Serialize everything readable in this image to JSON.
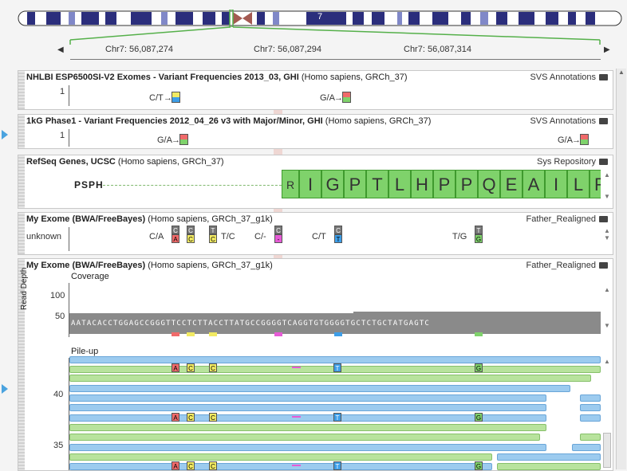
{
  "ideogram": {
    "chromosome_label": "7"
  },
  "ruler": {
    "labels": [
      "Chr7: 56,087,274",
      "Chr7: 56,087,294",
      "Chr7: 56,087,314"
    ]
  },
  "tracks": {
    "esp": {
      "title_bold": "NHLBI ESP6500SI-V2 Exomes - Variant Frequencies 2013_03, GHI",
      "title_rest": " (Homo sapiens, GRCh_37)",
      "source": "SVS Annotations",
      "axis": "1",
      "variants": [
        "C/T",
        "G/A"
      ]
    },
    "kg": {
      "title_bold": "1kG Phase1 - Variant Frequencies 2012_04_26 v3 with Major/Minor, GHI",
      "title_rest": " (Homo sapiens, GRCh_37)",
      "source": "SVS Annotations",
      "axis": "1",
      "variants": [
        "G/A",
        "G/A"
      ]
    },
    "refseq": {
      "title_bold": "RefSeq Genes, UCSC",
      "title_rest": " (Homo sapiens, GRCh_37)",
      "source": "Sys Repository",
      "gene": "PSPH",
      "amino_acids": [
        "R",
        "I",
        "G",
        "P",
        "T",
        "L",
        "H",
        "P",
        "P",
        "Q",
        "E",
        "A",
        "I",
        "L",
        "R"
      ]
    },
    "exome1": {
      "title_bold": "My Exome (BWA/FreeBayes)",
      "title_rest": " (Homo sapiens, GRCh_37_g1k)",
      "source": "Father_Realigned",
      "axis": "unknown",
      "variants": [
        "C/A",
        "T/C",
        "C/-",
        "C/T",
        "T/G"
      ],
      "genotypes": [
        {
          "top": "C",
          "bot": "A",
          "color": "#f06a6a"
        },
        {
          "top": "C",
          "bot": "C",
          "color": "#f2ea62"
        },
        {
          "top": "T",
          "bot": "C",
          "color": "#f2ea62"
        },
        {
          "top": "C",
          "bot": "-",
          "color": "#e65bd6"
        },
        {
          "top": "C",
          "bot": "T",
          "color": "#3d9ee8"
        },
        {
          "top": "T",
          "bot": "G",
          "color": "#7fd26b"
        }
      ]
    },
    "exome2": {
      "title_bold": "My Exome (BWA/FreeBayes)",
      "title_rest": " (Homo sapiens, GRCh_37_g1k)",
      "source": "Father_Realigned",
      "coverage_label": "Coverage",
      "y_axis_label": "Read Depth",
      "ticks": [
        "100",
        "50"
      ],
      "sequence": "AATACACCTGGAGCCGGGTTCCTCTTACCTTATGCCGGGGTCAGGTGTGGGGTGCTCTGCTATGAGTC",
      "pileup_label": "Pile-up",
      "pileup_ticks": [
        "40",
        "35"
      ],
      "pileup_bases": [
        "A",
        "C",
        "C",
        "T",
        "G"
      ]
    }
  }
}
